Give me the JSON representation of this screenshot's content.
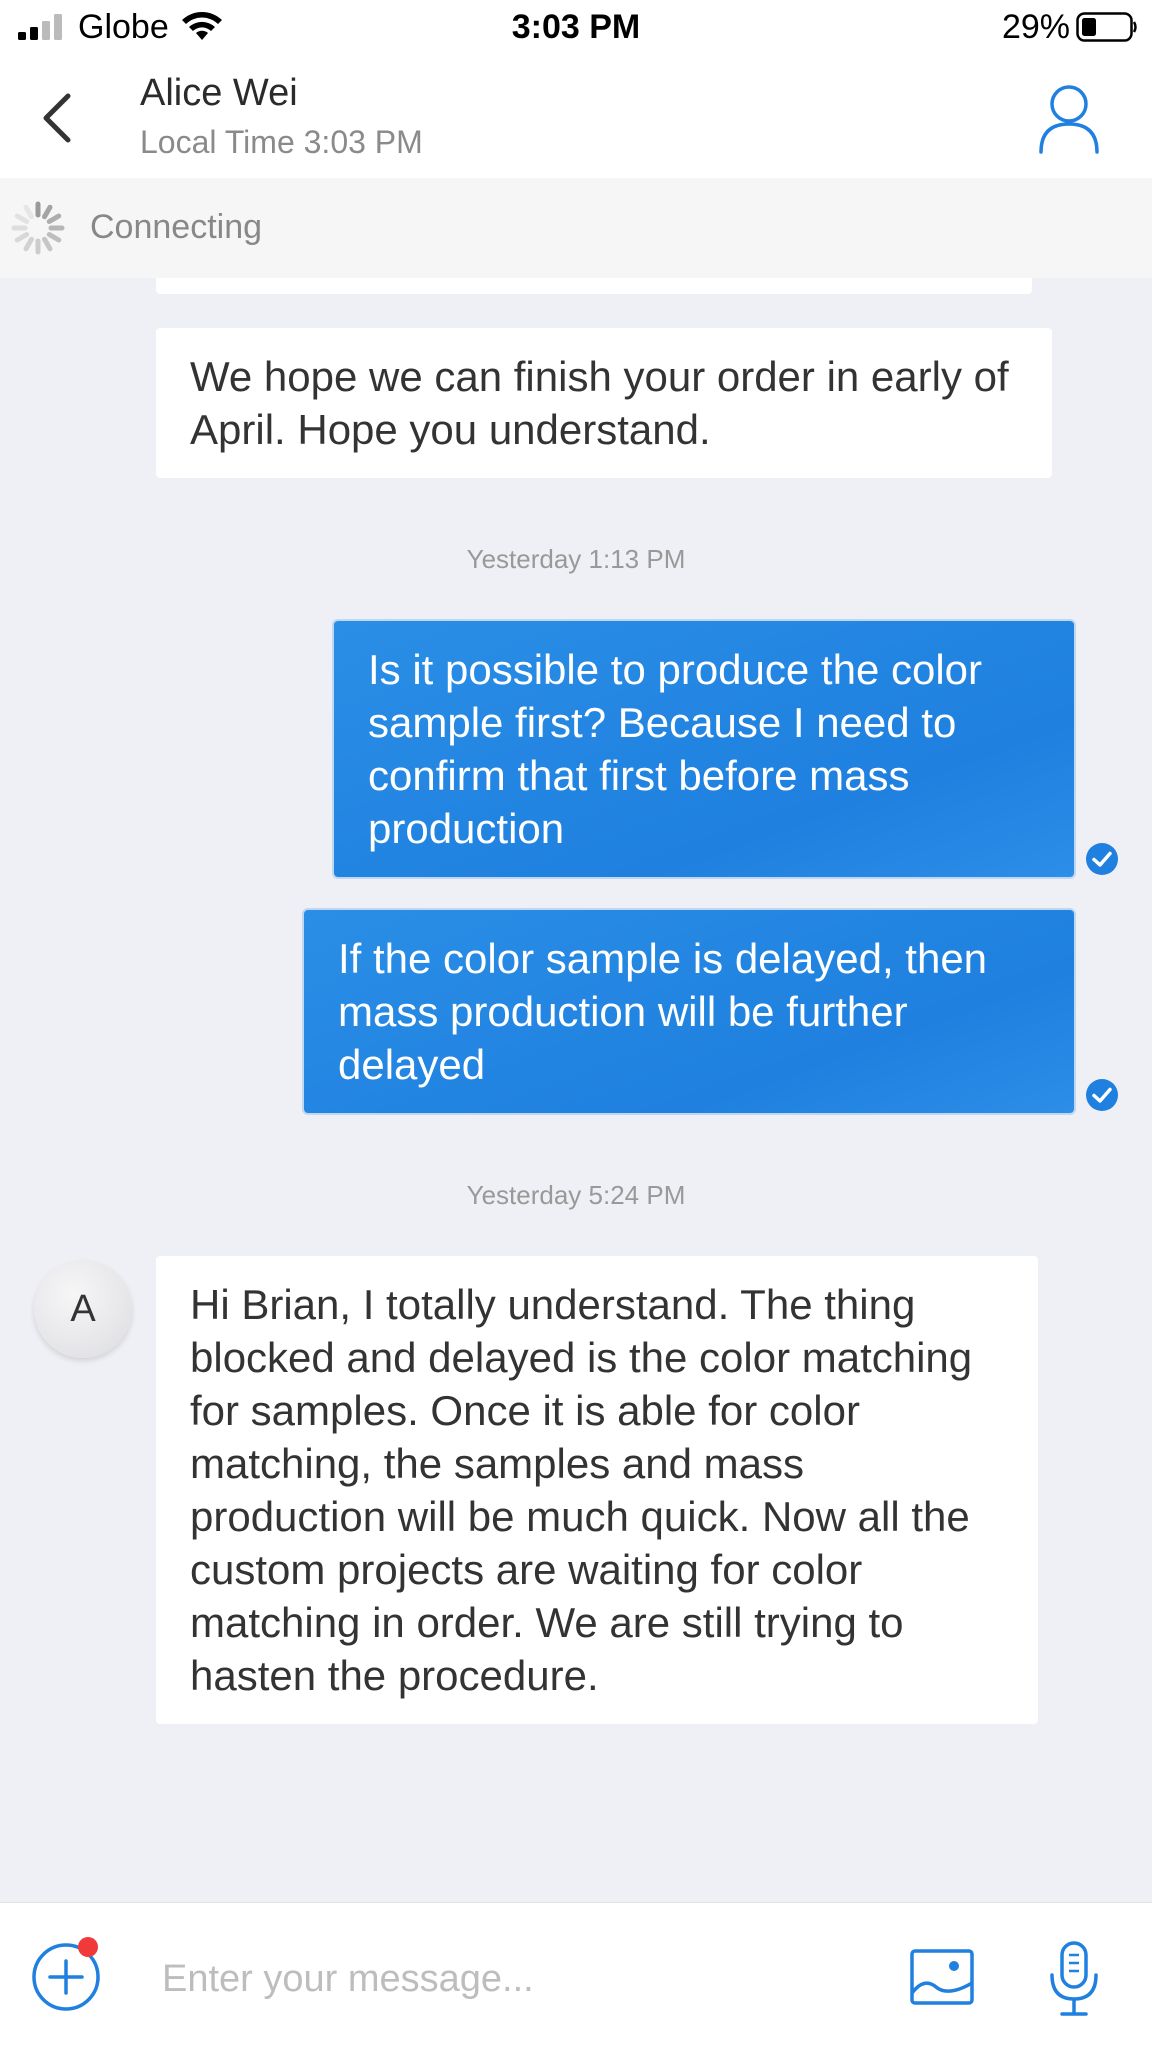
{
  "status_bar": {
    "carrier": "Globe",
    "time": "3:03 PM",
    "battery_percent": "29%"
  },
  "header": {
    "contact_name": "Alice Wei",
    "local_time": "Local Time 3:03 PM"
  },
  "connection": {
    "status": "Connecting"
  },
  "messages": [
    {
      "direction": "incoming",
      "text": "We hope we can finish your order in early of April. Hope you understand."
    },
    {
      "type": "timestamp",
      "text": "Yesterday 1:13 PM"
    },
    {
      "direction": "outgoing",
      "text": "Is it possible to produce the color sample first? Because I need to confirm that first before mass production",
      "read": true
    },
    {
      "direction": "outgoing",
      "text": "If the color sample is delayed, then mass production will be further delayed",
      "read": true
    },
    {
      "type": "timestamp",
      "text": "Yesterday 5:24 PM"
    },
    {
      "direction": "incoming",
      "avatar_letter": "A",
      "text": "Hi Brian, I totally understand. The thing blocked and delayed is the color matching for samples. Once it is able for color matching, the samples and mass production will be much quick. Now all the custom projects are waiting for color matching in order. We are still trying to hasten the procedure."
    }
  ],
  "input": {
    "placeholder": "Enter your message..."
  },
  "colors": {
    "accent": "#1f80df",
    "background": "#eff0f5",
    "notification_dot": "#f03a3a"
  },
  "icons": {
    "back": "chevron-left-icon",
    "profile": "user-icon",
    "spinner": "loading-spinner-icon",
    "read": "check-circle-icon",
    "plus": "plus-circle-icon",
    "image": "image-icon",
    "mic": "microphone-icon"
  }
}
